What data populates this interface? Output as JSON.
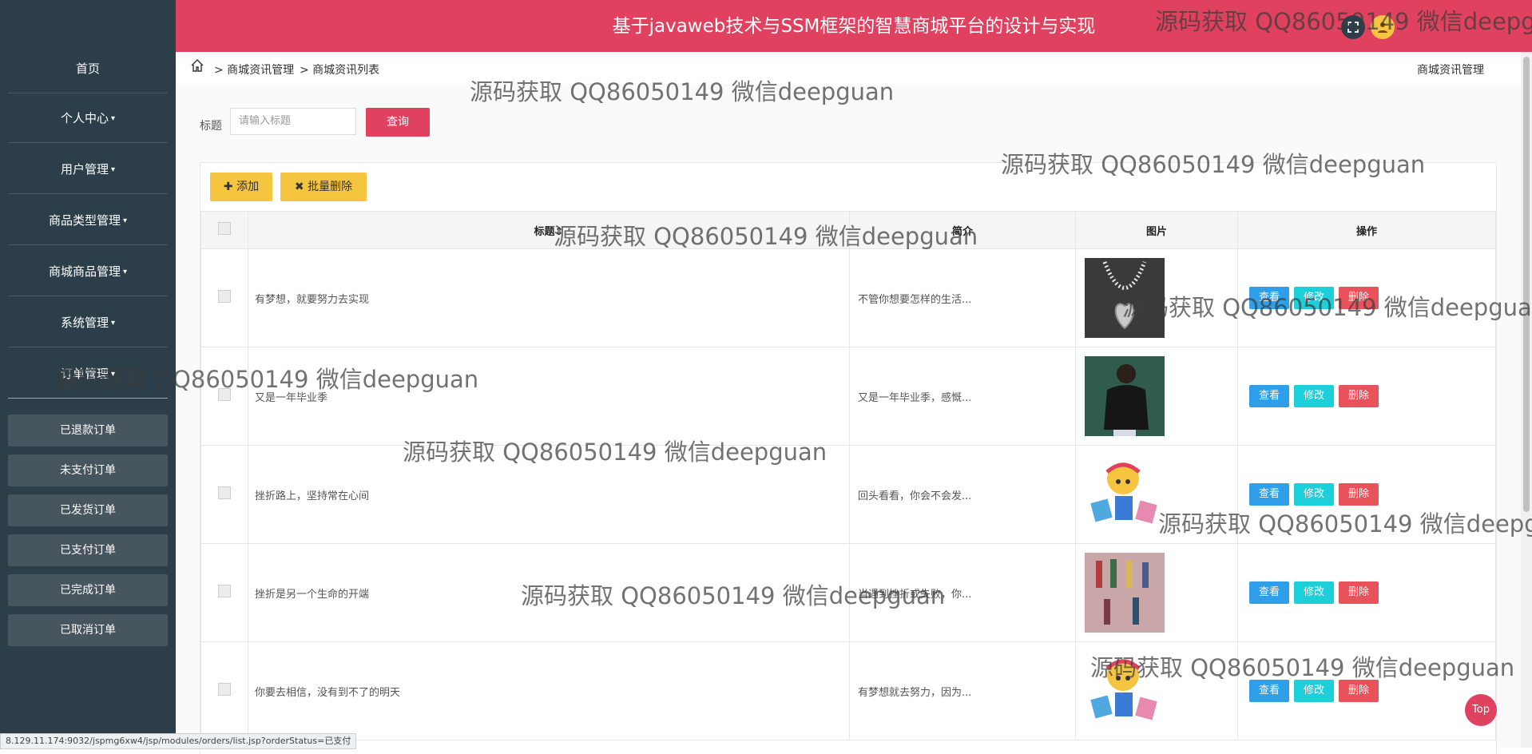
{
  "header": {
    "title": "基于javaweb技术与SSM框架的智慧商城平台的设计与实现",
    "fullscreen_icon": "fullscreen-icon",
    "user_icon": "user-avatar-icon"
  },
  "sidebar": {
    "items": [
      {
        "label": "首页",
        "caret": ""
      },
      {
        "label": "个人中心",
        "caret": "▾"
      },
      {
        "label": "用户管理",
        "caret": "▾"
      },
      {
        "label": "商品类型管理",
        "caret": "▾"
      },
      {
        "label": "商城商品管理",
        "caret": "▾"
      },
      {
        "label": "系统管理",
        "caret": "▾"
      },
      {
        "label": "订单管理",
        "caret": "▾"
      }
    ],
    "sub_items": [
      "已退款订单",
      "未支付订单",
      "已发货订单",
      "已支付订单",
      "已完成订单",
      "已取消订单"
    ]
  },
  "breadcrumb": {
    "home_icon": "home-icon",
    "items": [
      "> 商城资讯管理",
      "> 商城资讯列表"
    ],
    "right": "商城资讯管理"
  },
  "search": {
    "label": "标题",
    "placeholder": "请输入标题",
    "button": "查询"
  },
  "toolbar": {
    "add_label": "添加",
    "batch_delete_label": "批量删除"
  },
  "table": {
    "headers": {
      "title": "标题",
      "intro": "简介",
      "image": "图片",
      "actions": "操作"
    },
    "rows": [
      {
        "title": "有梦想，就要努力去实现",
        "intro": "不管你想要怎样的生活...",
        "image": "necklace-image"
      },
      {
        "title": "又是一年毕业季",
        "intro": "又是一年毕业季，感慨...",
        "image": "girl-jacket-image"
      },
      {
        "title": "挫折路上，坚持常在心间",
        "intro": "回头看看，你会不会发...",
        "image": "cartoon-shopper-image"
      },
      {
        "title": "挫折是另一个生命的开端",
        "intro": "当遇到挫折或失败，你...",
        "image": "fashion-collage-image"
      },
      {
        "title": "你要去相信，没有到不了的明天",
        "intro": "有梦想就去努力，因为...",
        "image": "cartoon-shopper-image"
      }
    ],
    "actions": {
      "view": "查看",
      "edit": "修改",
      "delete": "删除"
    }
  },
  "colors": {
    "primary": "#e0415f",
    "sidebar": "#2c3e4a",
    "view": "#2e9fe8",
    "edit": "#1ccfd8",
    "delete": "#e8525a",
    "yellow": "#f6c540"
  },
  "top_button": "Top",
  "status_url": "8.129.11.174:9032/jspmg6xw4/jsp/modules/orders/list.jsp?orderStatus=已支付",
  "watermark": "源码获取 QQ86050149 微信deepguan"
}
